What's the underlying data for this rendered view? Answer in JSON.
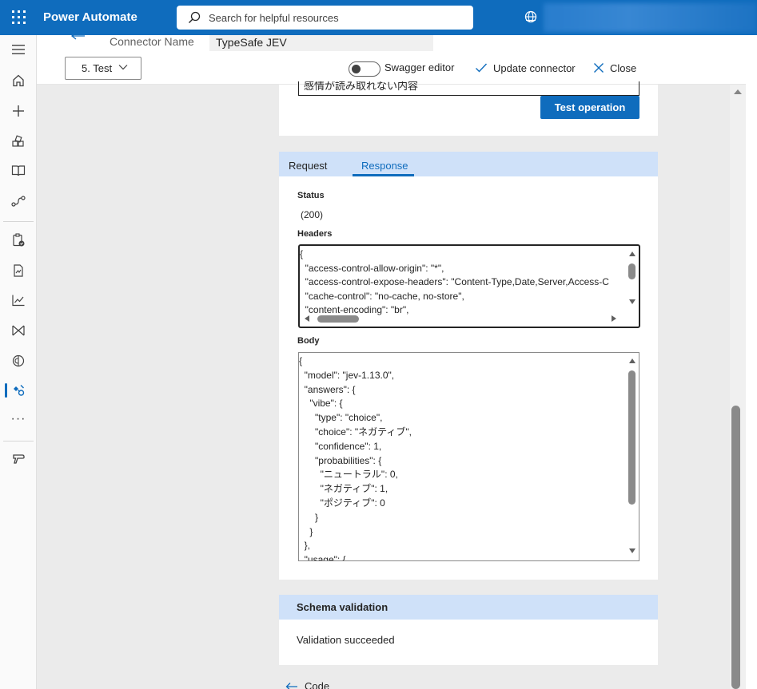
{
  "app": {
    "title": "Power Automate",
    "search_placeholder": "Search for helpful resources"
  },
  "rail": {
    "items": [
      "menu-icon",
      "home-icon",
      "create-icon",
      "templates-icon",
      "learn-icon",
      "connectors-icon",
      "approvals-icon",
      "process-mining-icon",
      "monitor-icon",
      "desktop-flows-icon",
      "ai-hub-icon",
      "custom-connectors-icon",
      "more-icon",
      "solutions-icon"
    ],
    "active": "custom-connectors-icon"
  },
  "header": {
    "connector_name_label": "Connector Name",
    "connector_name_value": "TypeSafe JEV"
  },
  "toolbar": {
    "step": "5. Test",
    "swagger_label": "Swagger editor",
    "swagger_on": false,
    "update_label": "Update connector",
    "close_label": "Close"
  },
  "test": {
    "payload_fragment": "感情が読み取れない内容",
    "test_button": "Test operation"
  },
  "response": {
    "tabs": [
      "Request",
      "Response"
    ],
    "selected_tab": "Response",
    "status_label": "Status",
    "status_value": "(200)",
    "headers_label": "Headers",
    "headers_lines": [
      "{",
      "  \"access-control-allow-origin\": \"*\",",
      "  \"access-control-expose-headers\": \"Content-Type,Date,Server,Access-C",
      "  \"cache-control\": \"no-cache, no-store\",",
      "  \"content-encoding\": \"br\","
    ],
    "body_label": "Body",
    "body_lines": [
      "{",
      "  \"model\": \"jev-1.13.0\",",
      "  \"answers\": {",
      "    \"vibe\": {",
      "      \"type\": \"choice\",",
      "      \"choice\": \"ネガティブ\",",
      "      \"confidence\": 1,",
      "      \"probabilities\": {",
      "        \"ニュートラル\": 0,",
      "        \"ネガティブ\": 1,",
      "        \"ポジティブ\": 0",
      "      }",
      "    }",
      "  },",
      "  \"usage\": {"
    ]
  },
  "schema": {
    "title": "Schema validation",
    "message": "Validation succeeded"
  },
  "footer": {
    "code_link": "Code"
  },
  "colors": {
    "brand": "#0f6cbd",
    "tab_bg": "#cfe1f9",
    "canvas": "#ebebeb"
  }
}
